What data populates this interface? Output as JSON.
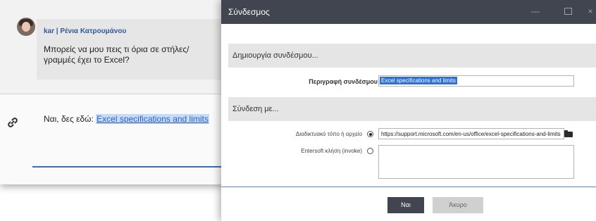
{
  "chat": {
    "sender": "kar | Ρένια Κατρουμάνου",
    "message": "Μπορείς να μου πεις τι όρια σε στήλες/γραμμές έχει το Excel?",
    "reply_prefix": "Ναι, δες εδώ: ",
    "reply_link": "Excel specifications and limits"
  },
  "dialog": {
    "title": "Σύνδεσμος",
    "window_buttons": {
      "minimize": "—",
      "close": "×"
    },
    "section_create": "Δημιουργία συνδέσμου...",
    "description_label": "Περιγραφή συνδέσμου",
    "description_value": "Excel specifications and limits",
    "section_link_to": "Σύνδεση με...",
    "option_web_label": "Διαδικτυακό τόπο ή αρχείο",
    "option_web_selected": true,
    "url_value": "https://support.microsoft.com/en-us/office/excel-specifications-and-limits",
    "option_invoke_label": "Entersoft κλήση (invoke)",
    "option_invoke_selected": false,
    "invoke_value": "",
    "ok_label": "Ναι",
    "cancel_label": "Άκυρο"
  },
  "icons": [
    "avatar",
    "link-icon",
    "folder-icon",
    "minimize-icon",
    "maximize-icon",
    "close-icon"
  ],
  "colors": {
    "titlebar": "#40454f",
    "link": "#2f5fc4",
    "selection": "#2f6fd6",
    "accent_line": "#3a6db4"
  }
}
